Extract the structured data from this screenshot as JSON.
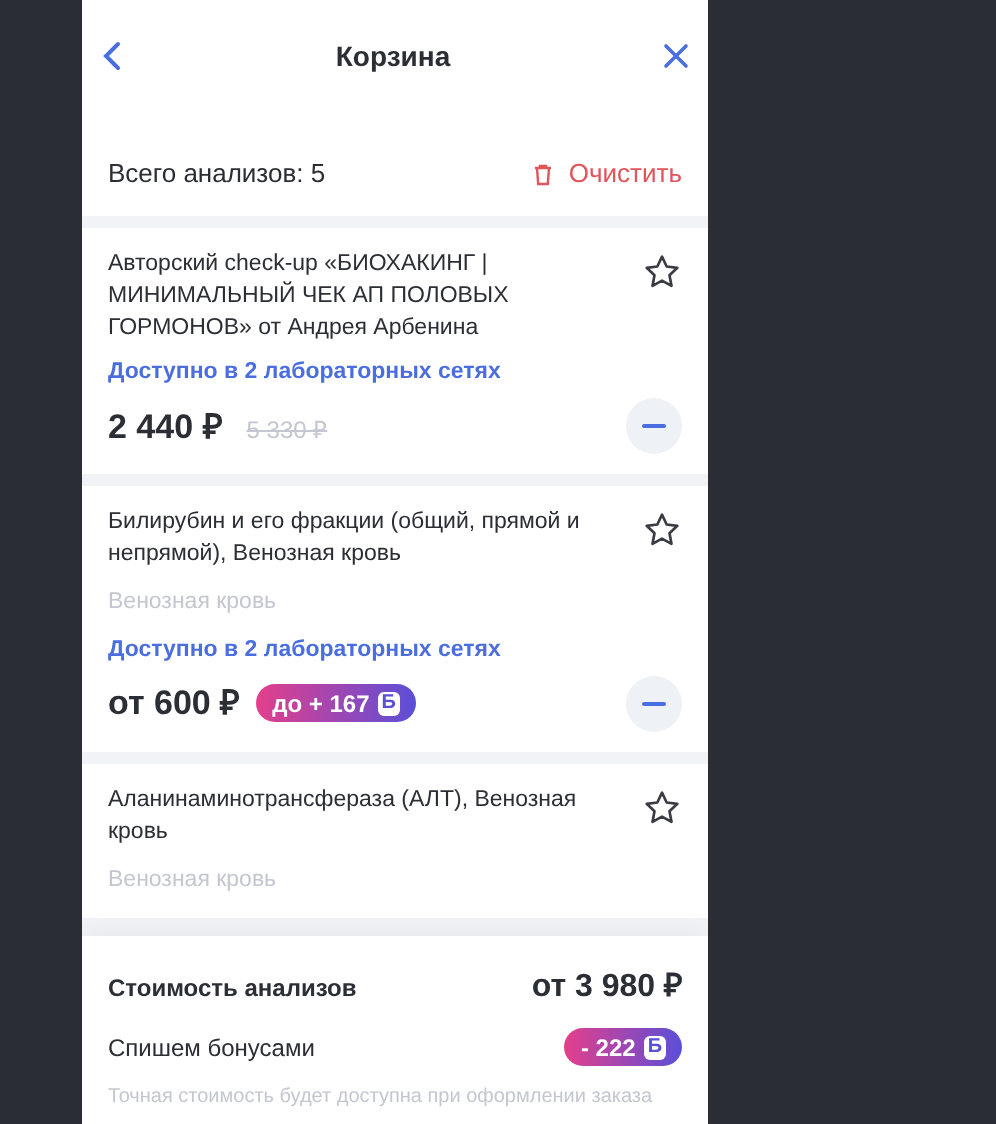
{
  "header": {
    "title": "Корзина"
  },
  "summary": {
    "total": "Всего анализов: 5",
    "clear": "Очистить"
  },
  "items": [
    {
      "kind": "discount",
      "name": "Авторский check-up «БИОХАКИНГ | МИНИМАЛЬНЫЙ ЧЕК АП ПОЛОВЫХ ГОРМОНОВ» от Андрея Арбенина",
      "availability": "Доступно в 2 лабораторных сетях",
      "price": "2 440 ₽",
      "old_price": "5 330 ₽"
    },
    {
      "kind": "bonus",
      "name": "Билирубин и его фракции (общий, прямой и непрямой), Венозная кровь",
      "material": "Венозная кровь",
      "availability": "Доступно в 2 лабораторных сетях",
      "price": "от 600 ₽",
      "bonus": "до + 167",
      "bonus_sign": "Б"
    },
    {
      "kind": "partial",
      "name": "Аланинаминотрансфераза (АЛТ), Венозная кровь",
      "material": "Венозная кровь"
    }
  ],
  "footer": {
    "cost_label": "Стоимость анализов",
    "cost": "от 3 980 ₽",
    "bonus_label": "Спишем бонусами",
    "bonus": "- 222",
    "bonus_sign": "Б",
    "note": "Точная стоимость будет доступна при оформлении заказа"
  }
}
